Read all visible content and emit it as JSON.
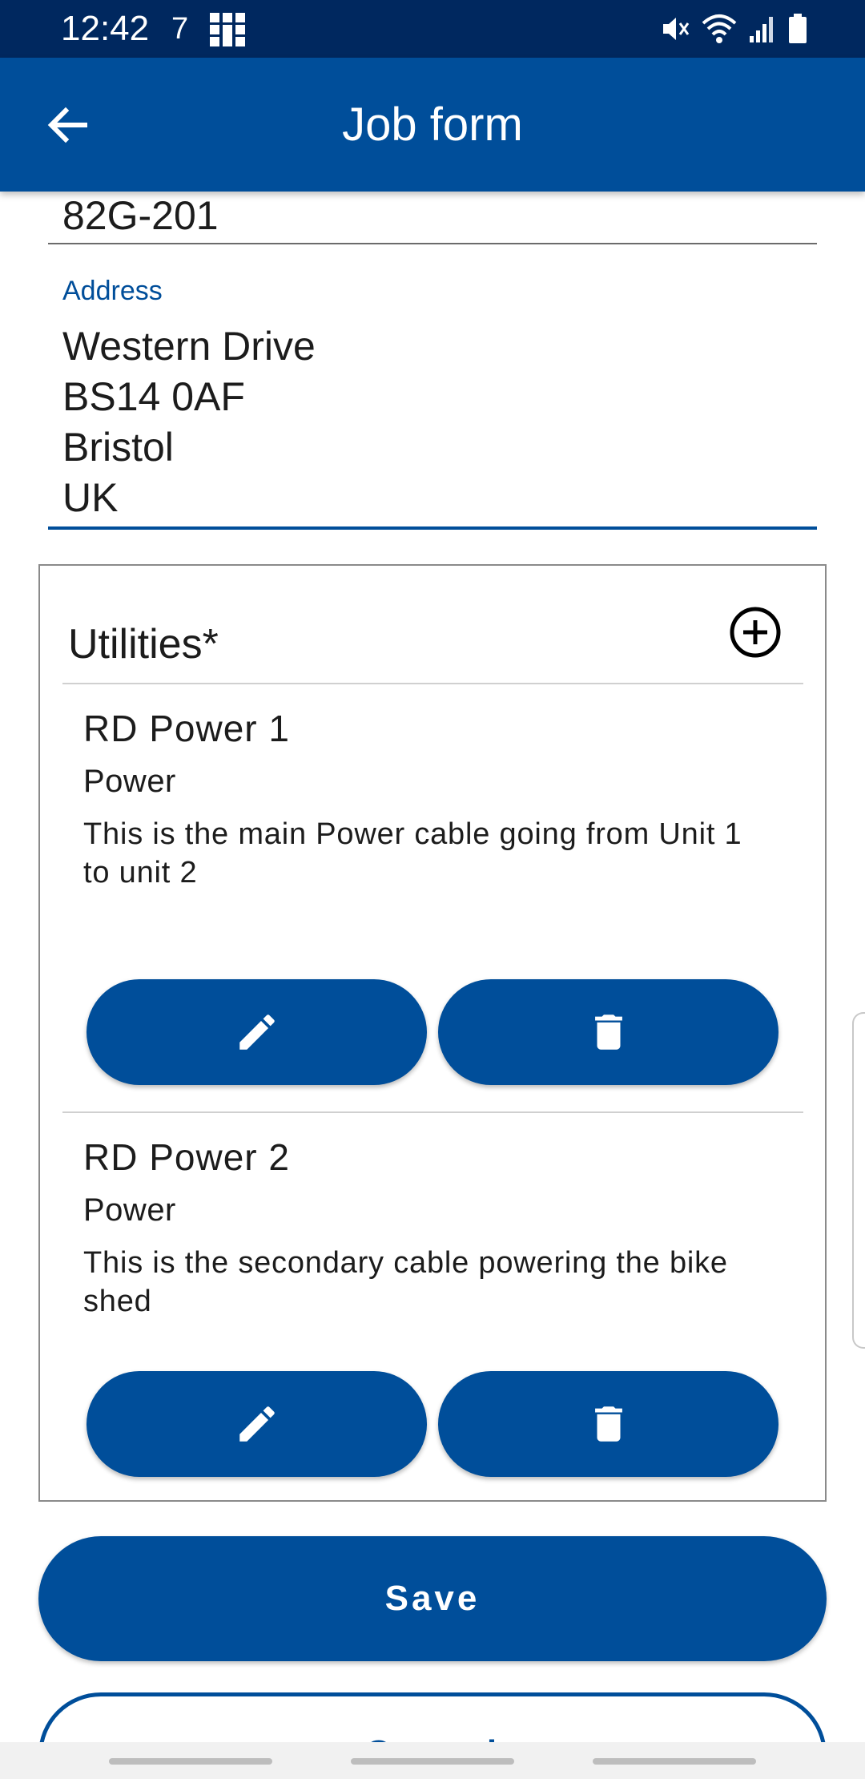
{
  "status_bar": {
    "time": "12:42",
    "notification": "7",
    "icons": [
      "grid-icon",
      "mute-icon",
      "wifi-icon",
      "signal-icon",
      "battery-icon"
    ]
  },
  "app_bar": {
    "title": "Job form",
    "back_icon": "arrow-back-icon"
  },
  "form": {
    "reference_value": "82G-201",
    "address": {
      "label": "Address",
      "lines": [
        "Western Drive",
        "BS14 0AF",
        "Bristol",
        "UK"
      ]
    }
  },
  "utilities": {
    "title": "Utilities*",
    "add_icon": "add-circle-icon",
    "items": [
      {
        "name": "RD Power 1",
        "type": "Power",
        "description": "This is the main Power cable going from Unit 1 to unit 2",
        "edit_icon": "pencil-icon",
        "delete_icon": "trash-icon"
      },
      {
        "name": "RD Power 2",
        "type": "Power",
        "description": "This is the secondary cable powering the bike shed",
        "edit_icon": "pencil-icon",
        "delete_icon": "trash-icon"
      }
    ]
  },
  "actions": {
    "save_label": "Save",
    "cancel_label": "Cancel"
  },
  "colors": {
    "primary": "#004e9a",
    "status_bar": "#00285f",
    "text": "#1c1c1c"
  }
}
